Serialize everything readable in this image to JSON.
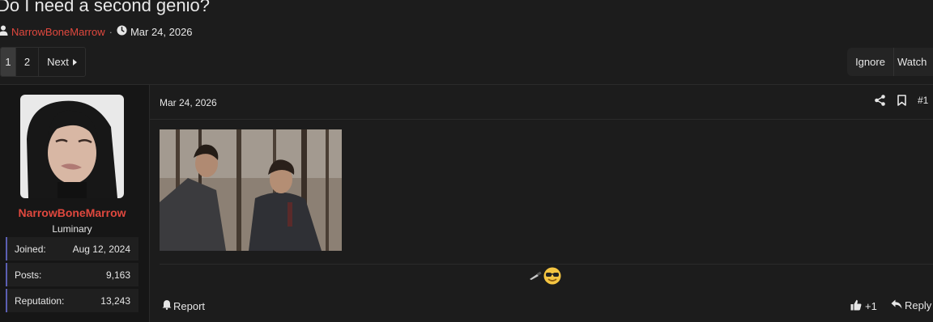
{
  "thread": {
    "title": "Do I need a second genio?",
    "author": "NarrowBoneMarrow",
    "separator": "·",
    "date": "Mar 24, 2026",
    "author_icon": "user-icon",
    "date_icon": "clock-icon"
  },
  "pagination": {
    "current": "1",
    "pages": [
      "2"
    ],
    "next_label": "Next",
    "next_icon": "caret-right-icon"
  },
  "thread_actions": {
    "ignore_label": "Ignore",
    "watch_label": "Watch"
  },
  "user": {
    "name": "NarrowBoneMarrow",
    "title": "Luminary",
    "name_color": "#e0483e",
    "stats": [
      {
        "label": "Joined:",
        "value": "Aug 12, 2024"
      },
      {
        "label": "Posts:",
        "value": "9,163"
      },
      {
        "label": "Reputation:",
        "value": "13,243"
      }
    ]
  },
  "post": {
    "date": "Mar 24, 2026",
    "number": "#1",
    "share_icon": "share-icon",
    "bookmark_icon": "bookmark-icon",
    "reactions": [
      "knife-icon",
      "sunglasses-emoji-icon"
    ],
    "report_label": "Report",
    "like_label": "+1",
    "reply_label": "Reply"
  },
  "colors": {
    "background": "#1c1c1c",
    "sidebar": "#161616",
    "accent_red": "#e0483e",
    "stat_border": "#5b5fb3"
  }
}
